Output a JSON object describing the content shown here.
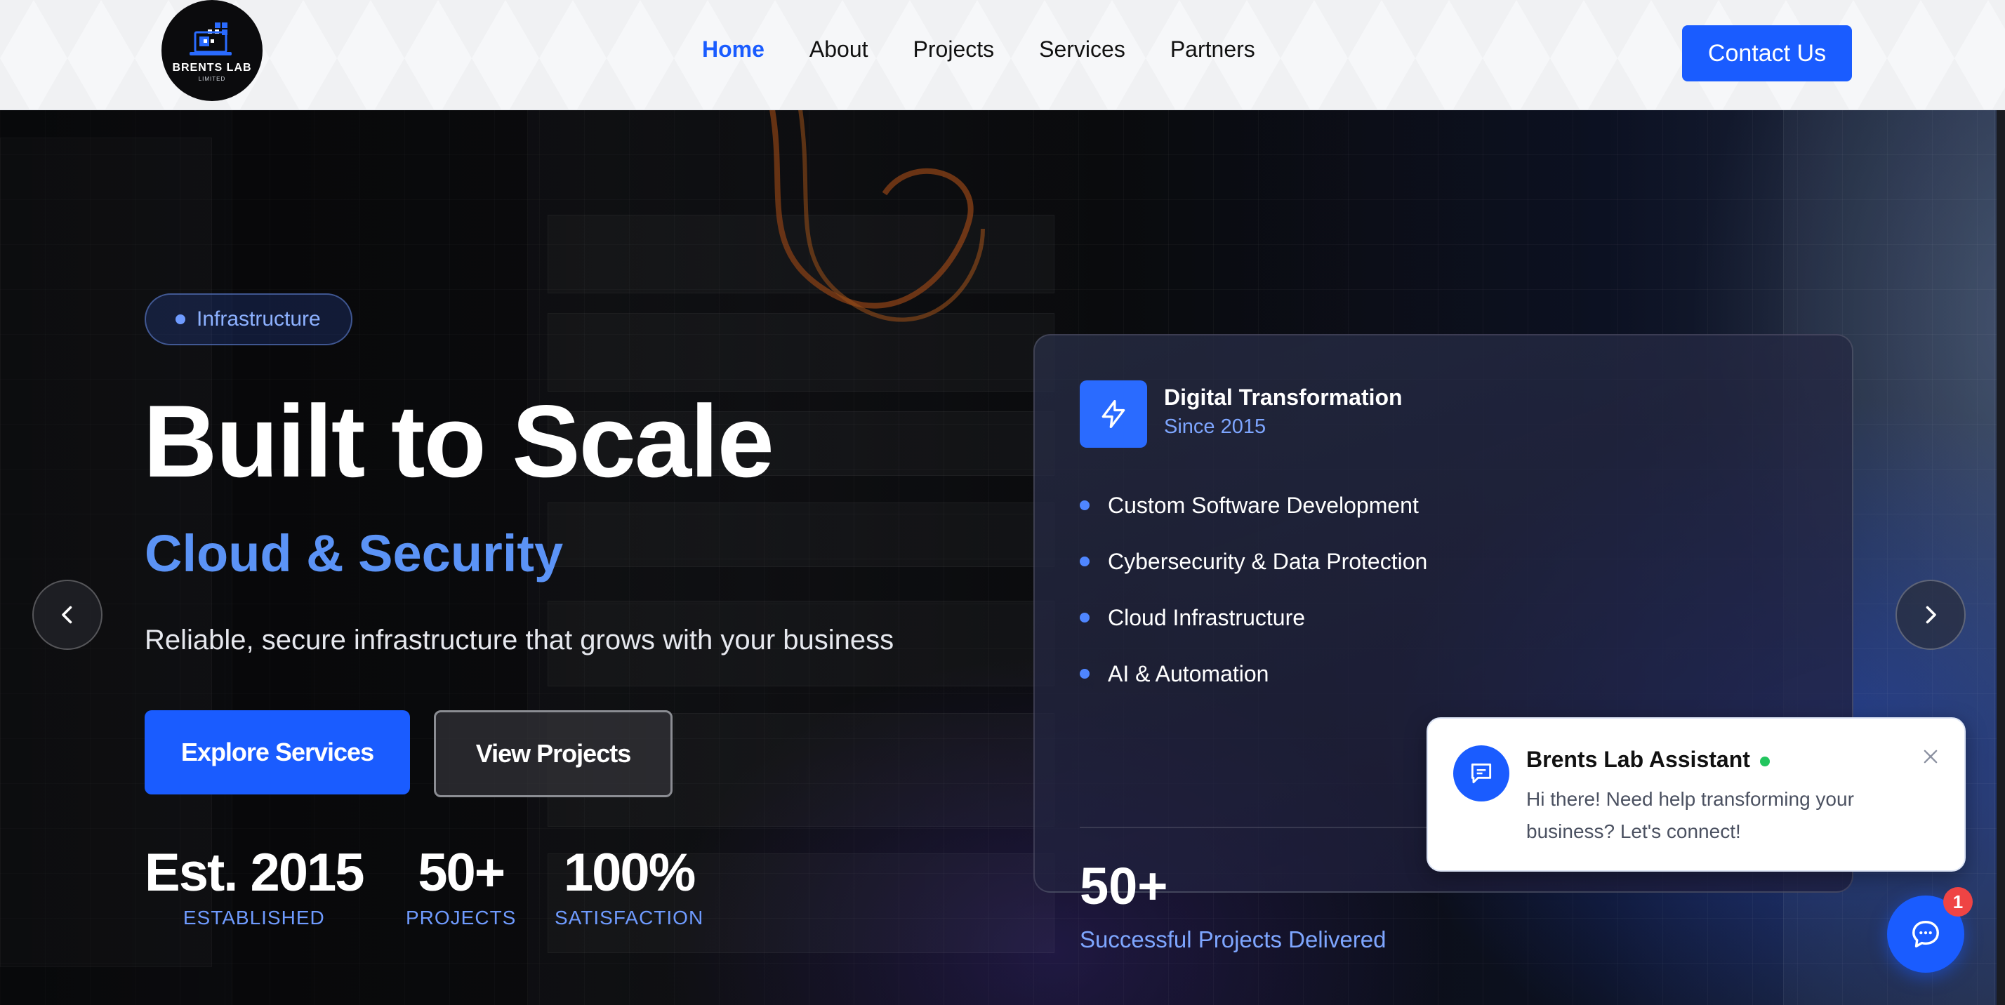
{
  "header": {
    "logo": {
      "name": "BRENTS LAB",
      "sub": "LIMITED"
    },
    "nav": [
      {
        "label": "Home",
        "active": true
      },
      {
        "label": "About"
      },
      {
        "label": "Projects"
      },
      {
        "label": "Services"
      },
      {
        "label": "Partners"
      }
    ],
    "contact_label": "Contact Us"
  },
  "hero": {
    "tag": "Infrastructure",
    "title": "Built to Scale",
    "subtitle": "Cloud & Security",
    "description": "Reliable, secure infrastructure that grows with your business",
    "primary_button": "Explore Services",
    "secondary_button": "View Projects",
    "stats": [
      {
        "value": "Est. 2015",
        "label": "ESTABLISHED"
      },
      {
        "value": "50+",
        "label": "PROJECTS"
      },
      {
        "value": "100%",
        "label": "SATISFACTION"
      }
    ],
    "prev_icon": "chevron-left-icon",
    "next_icon": "chevron-right-icon"
  },
  "card": {
    "icon": "lightning-icon",
    "title": "Digital Transformation",
    "since": "Since 2015",
    "items": [
      "Custom Software Development",
      "Cybersecurity & Data Protection",
      "Cloud Infrastructure",
      "AI & Automation"
    ],
    "stat_value": "50+",
    "stat_label": "Successful Projects Delivered"
  },
  "chat": {
    "name": "Brents Lab Assistant",
    "status": "online",
    "message": "Hi there! Need help transforming your business? Let's connect!",
    "badge": "1"
  },
  "colors": {
    "accent": "#1a5cff",
    "accent_light": "#5b93f6",
    "online": "#22c55e",
    "badge": "#ef4444"
  }
}
